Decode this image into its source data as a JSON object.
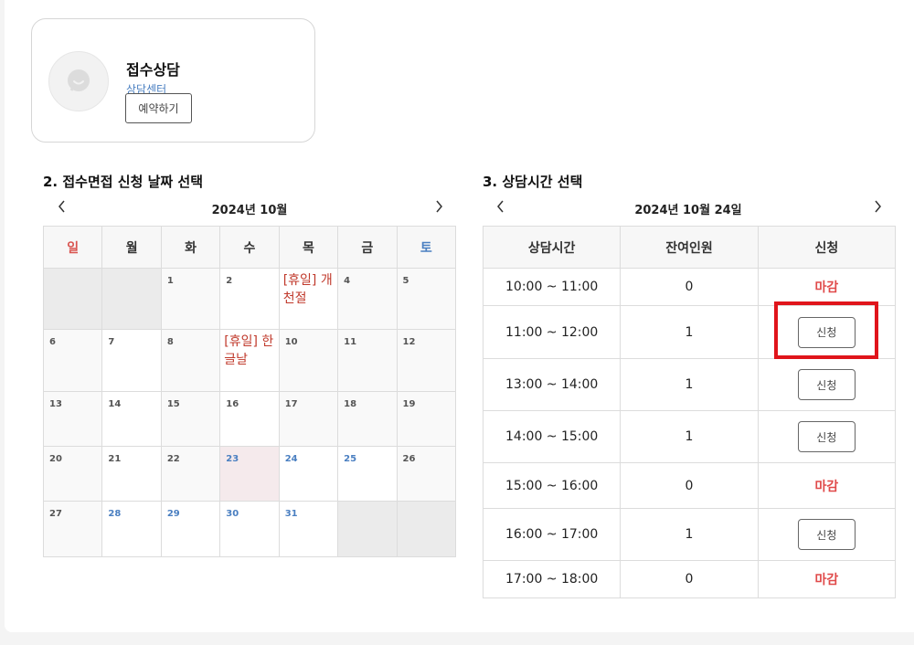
{
  "profile": {
    "name": "접수상담",
    "subtitle": "상담센터",
    "reserve_label": "예약하기"
  },
  "calendar": {
    "title": "2. 접수면접 신청 날짜 선택",
    "month_label": "2024년 10월",
    "weekdays": [
      "일",
      "월",
      "화",
      "수",
      "목",
      "금",
      "토"
    ],
    "weeks": [
      [
        {
          "text": "",
          "kind": "empty"
        },
        {
          "text": "",
          "kind": "empty"
        },
        {
          "text": "1",
          "kind": "past"
        },
        {
          "text": "2",
          "kind": "past-white"
        },
        {
          "text": "[휴일] 개천절",
          "kind": "holiday"
        },
        {
          "text": "4",
          "kind": "past"
        },
        {
          "text": "5",
          "kind": "past"
        }
      ],
      [
        {
          "text": "6",
          "kind": "past"
        },
        {
          "text": "7",
          "kind": "past-white"
        },
        {
          "text": "8",
          "kind": "past"
        },
        {
          "text": "[휴일] 한글날",
          "kind": "holiday"
        },
        {
          "text": "10",
          "kind": "past"
        },
        {
          "text": "11",
          "kind": "past"
        },
        {
          "text": "12",
          "kind": "past"
        }
      ],
      [
        {
          "text": "13",
          "kind": "past"
        },
        {
          "text": "14",
          "kind": "past-white"
        },
        {
          "text": "15",
          "kind": "past"
        },
        {
          "text": "16",
          "kind": "past-white"
        },
        {
          "text": "17",
          "kind": "past"
        },
        {
          "text": "18",
          "kind": "past"
        },
        {
          "text": "19",
          "kind": "past"
        }
      ],
      [
        {
          "text": "20",
          "kind": "past"
        },
        {
          "text": "21",
          "kind": "past-white"
        },
        {
          "text": "22",
          "kind": "past"
        },
        {
          "text": "23",
          "kind": "selected"
        },
        {
          "text": "24",
          "kind": "avail"
        },
        {
          "text": "25",
          "kind": "avail"
        },
        {
          "text": "26",
          "kind": "past"
        }
      ],
      [
        {
          "text": "27",
          "kind": "past"
        },
        {
          "text": "28",
          "kind": "avail"
        },
        {
          "text": "29",
          "kind": "avail"
        },
        {
          "text": "30",
          "kind": "avail"
        },
        {
          "text": "31",
          "kind": "avail"
        },
        {
          "text": "",
          "kind": "empty"
        },
        {
          "text": "",
          "kind": "empty"
        }
      ]
    ]
  },
  "times": {
    "title": "3. 상담시간 선택",
    "date_label": "2024년 10월 24일",
    "headers": [
      "상담시간",
      "잔여인원",
      "신청"
    ],
    "rows": [
      {
        "time": "10:00 ~ 11:00",
        "remaining": "0",
        "status": "마감",
        "open": false
      },
      {
        "time": "11:00 ~ 12:00",
        "remaining": "1",
        "status": "신청",
        "open": true
      },
      {
        "time": "13:00 ~ 14:00",
        "remaining": "1",
        "status": "신청",
        "open": true
      },
      {
        "time": "14:00 ~ 15:00",
        "remaining": "1",
        "status": "신청",
        "open": true
      },
      {
        "time": "15:00 ~ 16:00",
        "remaining": "0",
        "status": "마감",
        "open": false
      },
      {
        "time": "16:00 ~ 17:00",
        "remaining": "1",
        "status": "신청",
        "open": true
      },
      {
        "time": "17:00 ~ 18:00",
        "remaining": "0",
        "status": "마감",
        "open": false
      }
    ]
  },
  "colors": {
    "accent_blue": "#4a7fc1",
    "closed_red": "#e04a4a",
    "holiday_red": "#c0392b",
    "highlight_red": "#e0141b"
  }
}
